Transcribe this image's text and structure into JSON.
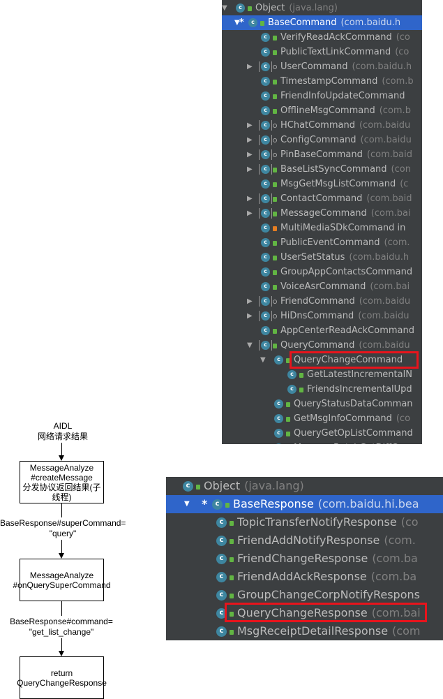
{
  "flow": {
    "top_label": "AIDL\n网络请求结果",
    "box1": "MessageAnalyze\n#createMessage\n分发协议返回结果(子\n线程)",
    "cond1": "BaseResponse#superCommand=\n\"query\"",
    "box2": "MessageAnalyze\n#onQuerySuperCommand",
    "cond2": "BaseResponse#command=\n\"get_list_change\"",
    "box3": "return\nQueryChangeResponse"
  },
  "command_tree": {
    "rows": [
      {
        "name": "Object",
        "pkg": "(java.lang)"
      },
      {
        "name": "BaseCommand",
        "pkg": "(com.baidu.h"
      },
      {
        "name": "VerifyReadAckCommand",
        "pkg": "(co"
      },
      {
        "name": "PublicTextLinkCommand",
        "pkg": "(co"
      },
      {
        "name": "UserCommand",
        "pkg": "(com.baidu.h"
      },
      {
        "name": "TimestampCommand",
        "pkg": "(com.b"
      },
      {
        "name": "FriendInfoUpdateCommand",
        "pkg": ""
      },
      {
        "name": "OfflineMsgCommand",
        "pkg": "(com.b"
      },
      {
        "name": "HChatCommand",
        "pkg": "(com.baidu"
      },
      {
        "name": "ConfigCommand",
        "pkg": "(com.baidu"
      },
      {
        "name": "PinBaseCommand",
        "pkg": "(com.baid"
      },
      {
        "name": "BaseListSyncCommand",
        "pkg": "(con"
      },
      {
        "name": "MsgGetMsgListCommand",
        "pkg": "(c"
      },
      {
        "name": "ContactCommand",
        "pkg": "(com.baid"
      },
      {
        "name": "MessageCommand",
        "pkg": "(com.bai"
      },
      {
        "name": "MultiMediaSDkCommand in",
        "pkg": ""
      },
      {
        "name": "PublicEventCommand",
        "pkg": "(com."
      },
      {
        "name": "UserSetStatus",
        "pkg": "(com.baidu.h"
      },
      {
        "name": "GroupAppContactsCommand",
        "pkg": ""
      },
      {
        "name": "VoiceAsrCommand",
        "pkg": "(com.bai"
      },
      {
        "name": "FriendCommand",
        "pkg": "(com.baidu"
      },
      {
        "name": "HiDnsCommand",
        "pkg": "(com.baidu"
      },
      {
        "name": "AppCenterReadAckCommand",
        "pkg": ""
      },
      {
        "name": "QueryCommand",
        "pkg": "(com.baidu"
      },
      {
        "name": "QueryChangeCommand",
        "pkg": ""
      },
      {
        "name": "GetLatestIncrementalN",
        "pkg": ""
      },
      {
        "name": "FriendsIncrementalUpd",
        "pkg": ""
      },
      {
        "name": "QueryStatusDataComman",
        "pkg": ""
      },
      {
        "name": "GetMsgInfoCommand",
        "pkg": "(co"
      },
      {
        "name": "QueryGetOpListCommand",
        "pkg": ""
      },
      {
        "name": "MessageBatchGetDiffC",
        "pkg": ""
      }
    ]
  },
  "response_tree": {
    "rows": [
      {
        "name": "Object",
        "pkg": "(java.lang)"
      },
      {
        "name": "BaseResponse",
        "pkg": "(com.baidu.hi.bea"
      },
      {
        "name": "TopicTransferNotifyResponse",
        "pkg": "(co"
      },
      {
        "name": "FriendAddNotifyResponse",
        "pkg": "(com."
      },
      {
        "name": "FriendChangeResponse",
        "pkg": "(com.ba"
      },
      {
        "name": "FriendAddAckResponse",
        "pkg": "(com.ba"
      },
      {
        "name": "GroupChangeCorpNotifyRespons",
        "pkg": ""
      },
      {
        "name": "QueryChangeResponse",
        "pkg": "(com.bai"
      },
      {
        "name": "MsgReceiptDetailResponse",
        "pkg": "(com"
      }
    ]
  },
  "icons": {
    "class_icon": "class-c-icon",
    "lock_icon": "lock-icon",
    "expand_icon": "triangle-down-icon",
    "collapse_icon": "triangle-right-icon"
  },
  "colors": {
    "panel_bg": "#3c3f41",
    "selection": "#2f65ca",
    "class_icon": "#3e86a0",
    "highlight_box": "#e8141c",
    "lock_green": "#62b543",
    "lock_orange": "#e67e22"
  }
}
